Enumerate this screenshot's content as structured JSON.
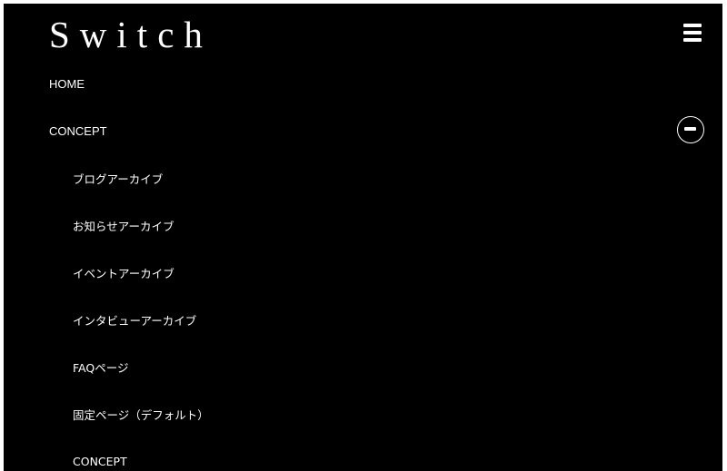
{
  "header": {
    "logo_text": "Switch",
    "menu_icon": "hamburger-menu-icon"
  },
  "nav": {
    "home_label": "HOME",
    "concept_label": "CONCEPT",
    "collapse_icon": "minus-circle-icon",
    "sub_items": [
      {
        "label": "ブログアーカイブ"
      },
      {
        "label": "お知らせアーカイブ"
      },
      {
        "label": "イベントアーカイブ"
      },
      {
        "label": "インタビューアーカイブ"
      },
      {
        "label": "FAQページ"
      },
      {
        "label": "固定ページ（デフォルト）"
      },
      {
        "label": "CONCEPT"
      }
    ]
  },
  "colors": {
    "background": "#000000",
    "text": "#ffffff"
  }
}
